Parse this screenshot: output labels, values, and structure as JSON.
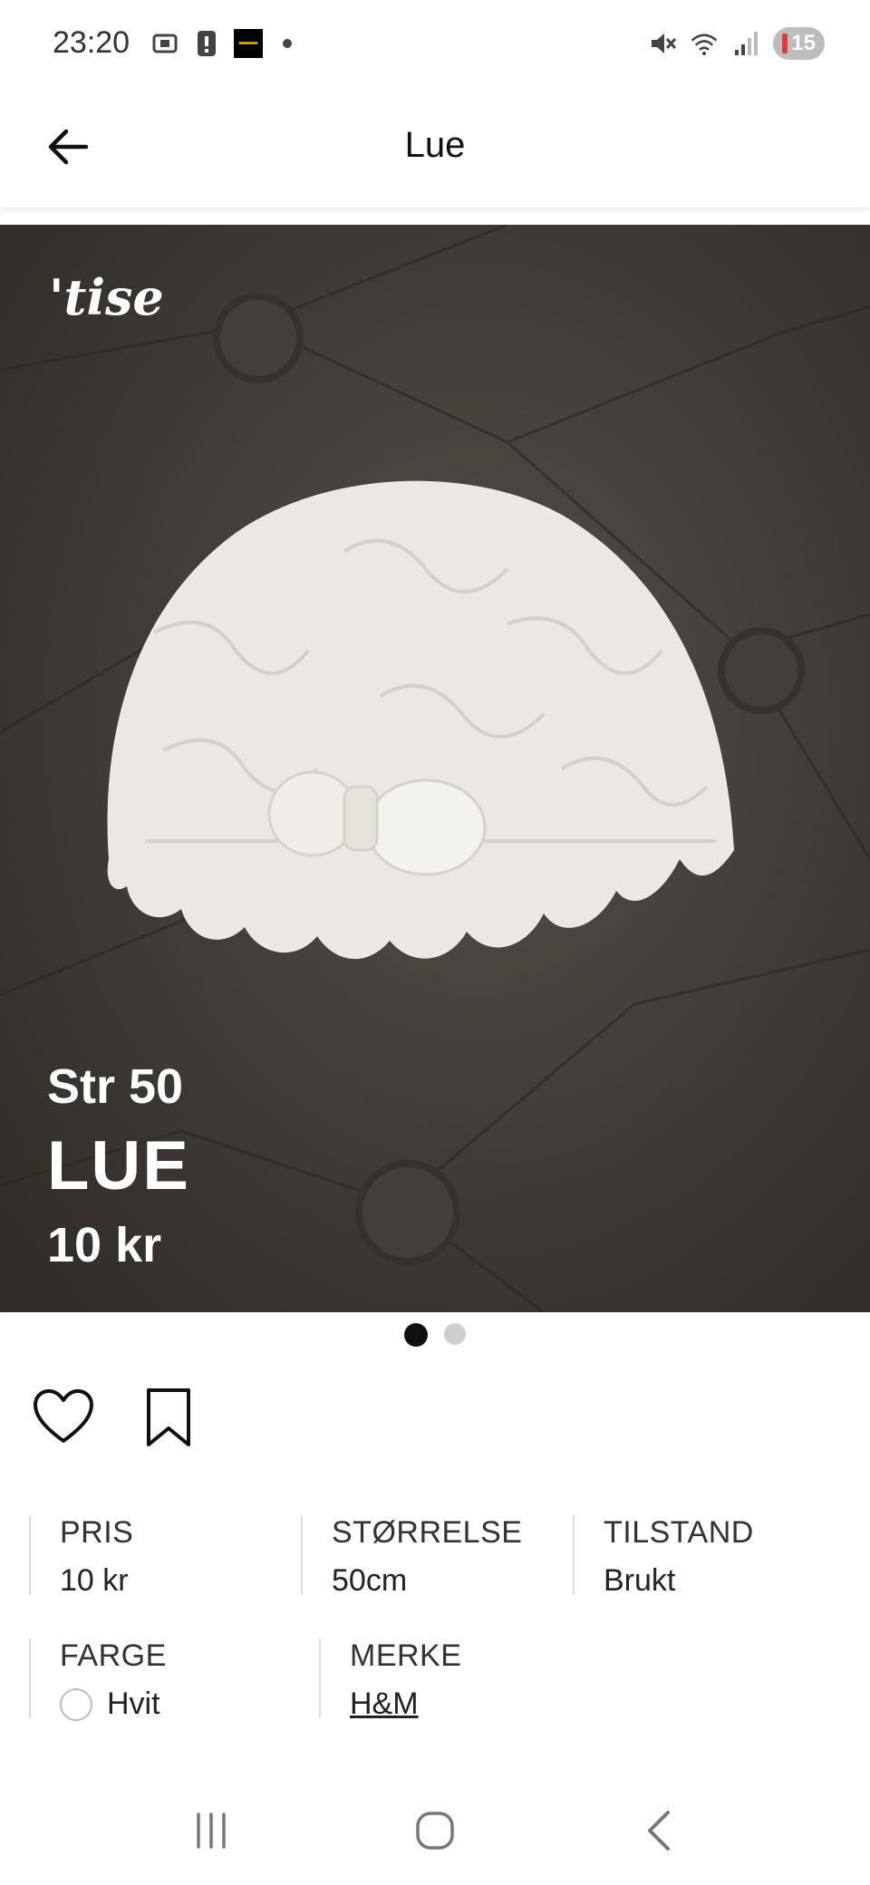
{
  "status_bar": {
    "time": "23:20",
    "left_icons": [
      "screenshot-icon",
      "alert-icon",
      "app-thumbnail-icon",
      "dot-icon"
    ],
    "right_icons": [
      "mute-icon",
      "wifi-icon",
      "signal-icon"
    ],
    "battery_level": "15"
  },
  "app_bar": {
    "title": "Lue"
  },
  "hero": {
    "watermark": "'tise",
    "size_text": "Str 50",
    "title_text": "LUE",
    "price_text": "10 kr"
  },
  "carousel": {
    "total": 2,
    "active_index": 0
  },
  "details": {
    "price": {
      "label": "PRIS",
      "value": "10 kr"
    },
    "size": {
      "label": "STØRRELSE",
      "value": "50cm"
    },
    "condition": {
      "label": "TILSTAND",
      "value": "Brukt"
    },
    "color": {
      "label": "FARGE",
      "value": "Hvit",
      "swatch": "#ffffff"
    },
    "brand": {
      "label": "MERKE",
      "value": "H&M"
    }
  },
  "colors": {
    "background": "#ffffff",
    "text": "#111111",
    "hero_bg": "#3e3a35"
  }
}
